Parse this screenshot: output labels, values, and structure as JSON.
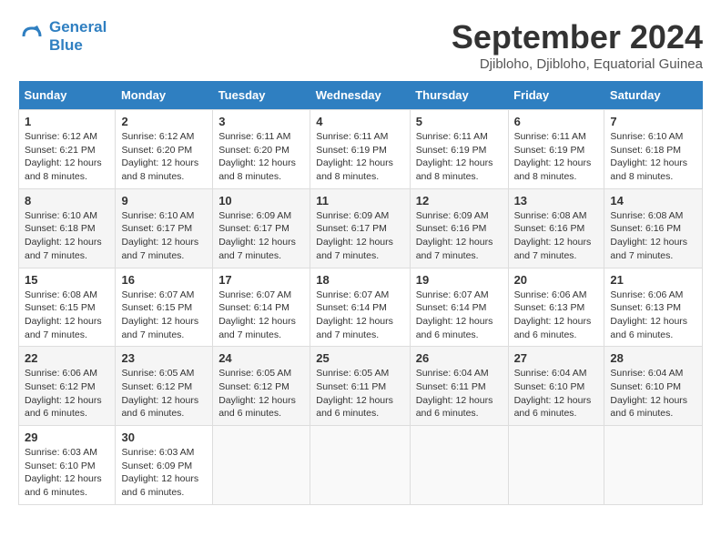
{
  "header": {
    "logo_line1": "General",
    "logo_line2": "Blue",
    "month": "September 2024",
    "location": "Djibloho, Djibloho, Equatorial Guinea"
  },
  "days_of_week": [
    "Sunday",
    "Monday",
    "Tuesday",
    "Wednesday",
    "Thursday",
    "Friday",
    "Saturday"
  ],
  "weeks": [
    [
      {
        "num": "1",
        "detail": "Sunrise: 6:12 AM\nSunset: 6:21 PM\nDaylight: 12 hours\nand 8 minutes."
      },
      {
        "num": "2",
        "detail": "Sunrise: 6:12 AM\nSunset: 6:20 PM\nDaylight: 12 hours\nand 8 minutes."
      },
      {
        "num": "3",
        "detail": "Sunrise: 6:11 AM\nSunset: 6:20 PM\nDaylight: 12 hours\nand 8 minutes."
      },
      {
        "num": "4",
        "detail": "Sunrise: 6:11 AM\nSunset: 6:19 PM\nDaylight: 12 hours\nand 8 minutes."
      },
      {
        "num": "5",
        "detail": "Sunrise: 6:11 AM\nSunset: 6:19 PM\nDaylight: 12 hours\nand 8 minutes."
      },
      {
        "num": "6",
        "detail": "Sunrise: 6:11 AM\nSunset: 6:19 PM\nDaylight: 12 hours\nand 8 minutes."
      },
      {
        "num": "7",
        "detail": "Sunrise: 6:10 AM\nSunset: 6:18 PM\nDaylight: 12 hours\nand 8 minutes."
      }
    ],
    [
      {
        "num": "8",
        "detail": "Sunrise: 6:10 AM\nSunset: 6:18 PM\nDaylight: 12 hours\nand 7 minutes."
      },
      {
        "num": "9",
        "detail": "Sunrise: 6:10 AM\nSunset: 6:17 PM\nDaylight: 12 hours\nand 7 minutes."
      },
      {
        "num": "10",
        "detail": "Sunrise: 6:09 AM\nSunset: 6:17 PM\nDaylight: 12 hours\nand 7 minutes."
      },
      {
        "num": "11",
        "detail": "Sunrise: 6:09 AM\nSunset: 6:17 PM\nDaylight: 12 hours\nand 7 minutes."
      },
      {
        "num": "12",
        "detail": "Sunrise: 6:09 AM\nSunset: 6:16 PM\nDaylight: 12 hours\nand 7 minutes."
      },
      {
        "num": "13",
        "detail": "Sunrise: 6:08 AM\nSunset: 6:16 PM\nDaylight: 12 hours\nand 7 minutes."
      },
      {
        "num": "14",
        "detail": "Sunrise: 6:08 AM\nSunset: 6:16 PM\nDaylight: 12 hours\nand 7 minutes."
      }
    ],
    [
      {
        "num": "15",
        "detail": "Sunrise: 6:08 AM\nSunset: 6:15 PM\nDaylight: 12 hours\nand 7 minutes."
      },
      {
        "num": "16",
        "detail": "Sunrise: 6:07 AM\nSunset: 6:15 PM\nDaylight: 12 hours\nand 7 minutes."
      },
      {
        "num": "17",
        "detail": "Sunrise: 6:07 AM\nSunset: 6:14 PM\nDaylight: 12 hours\nand 7 minutes."
      },
      {
        "num": "18",
        "detail": "Sunrise: 6:07 AM\nSunset: 6:14 PM\nDaylight: 12 hours\nand 7 minutes."
      },
      {
        "num": "19",
        "detail": "Sunrise: 6:07 AM\nSunset: 6:14 PM\nDaylight: 12 hours\nand 6 minutes."
      },
      {
        "num": "20",
        "detail": "Sunrise: 6:06 AM\nSunset: 6:13 PM\nDaylight: 12 hours\nand 6 minutes."
      },
      {
        "num": "21",
        "detail": "Sunrise: 6:06 AM\nSunset: 6:13 PM\nDaylight: 12 hours\nand 6 minutes."
      }
    ],
    [
      {
        "num": "22",
        "detail": "Sunrise: 6:06 AM\nSunset: 6:12 PM\nDaylight: 12 hours\nand 6 minutes."
      },
      {
        "num": "23",
        "detail": "Sunrise: 6:05 AM\nSunset: 6:12 PM\nDaylight: 12 hours\nand 6 minutes."
      },
      {
        "num": "24",
        "detail": "Sunrise: 6:05 AM\nSunset: 6:12 PM\nDaylight: 12 hours\nand 6 minutes."
      },
      {
        "num": "25",
        "detail": "Sunrise: 6:05 AM\nSunset: 6:11 PM\nDaylight: 12 hours\nand 6 minutes."
      },
      {
        "num": "26",
        "detail": "Sunrise: 6:04 AM\nSunset: 6:11 PM\nDaylight: 12 hours\nand 6 minutes."
      },
      {
        "num": "27",
        "detail": "Sunrise: 6:04 AM\nSunset: 6:10 PM\nDaylight: 12 hours\nand 6 minutes."
      },
      {
        "num": "28",
        "detail": "Sunrise: 6:04 AM\nSunset: 6:10 PM\nDaylight: 12 hours\nand 6 minutes."
      }
    ],
    [
      {
        "num": "29",
        "detail": "Sunrise: 6:03 AM\nSunset: 6:10 PM\nDaylight: 12 hours\nand 6 minutes."
      },
      {
        "num": "30",
        "detail": "Sunrise: 6:03 AM\nSunset: 6:09 PM\nDaylight: 12 hours\nand 6 minutes."
      },
      {
        "num": "",
        "detail": ""
      },
      {
        "num": "",
        "detail": ""
      },
      {
        "num": "",
        "detail": ""
      },
      {
        "num": "",
        "detail": ""
      },
      {
        "num": "",
        "detail": ""
      }
    ]
  ]
}
